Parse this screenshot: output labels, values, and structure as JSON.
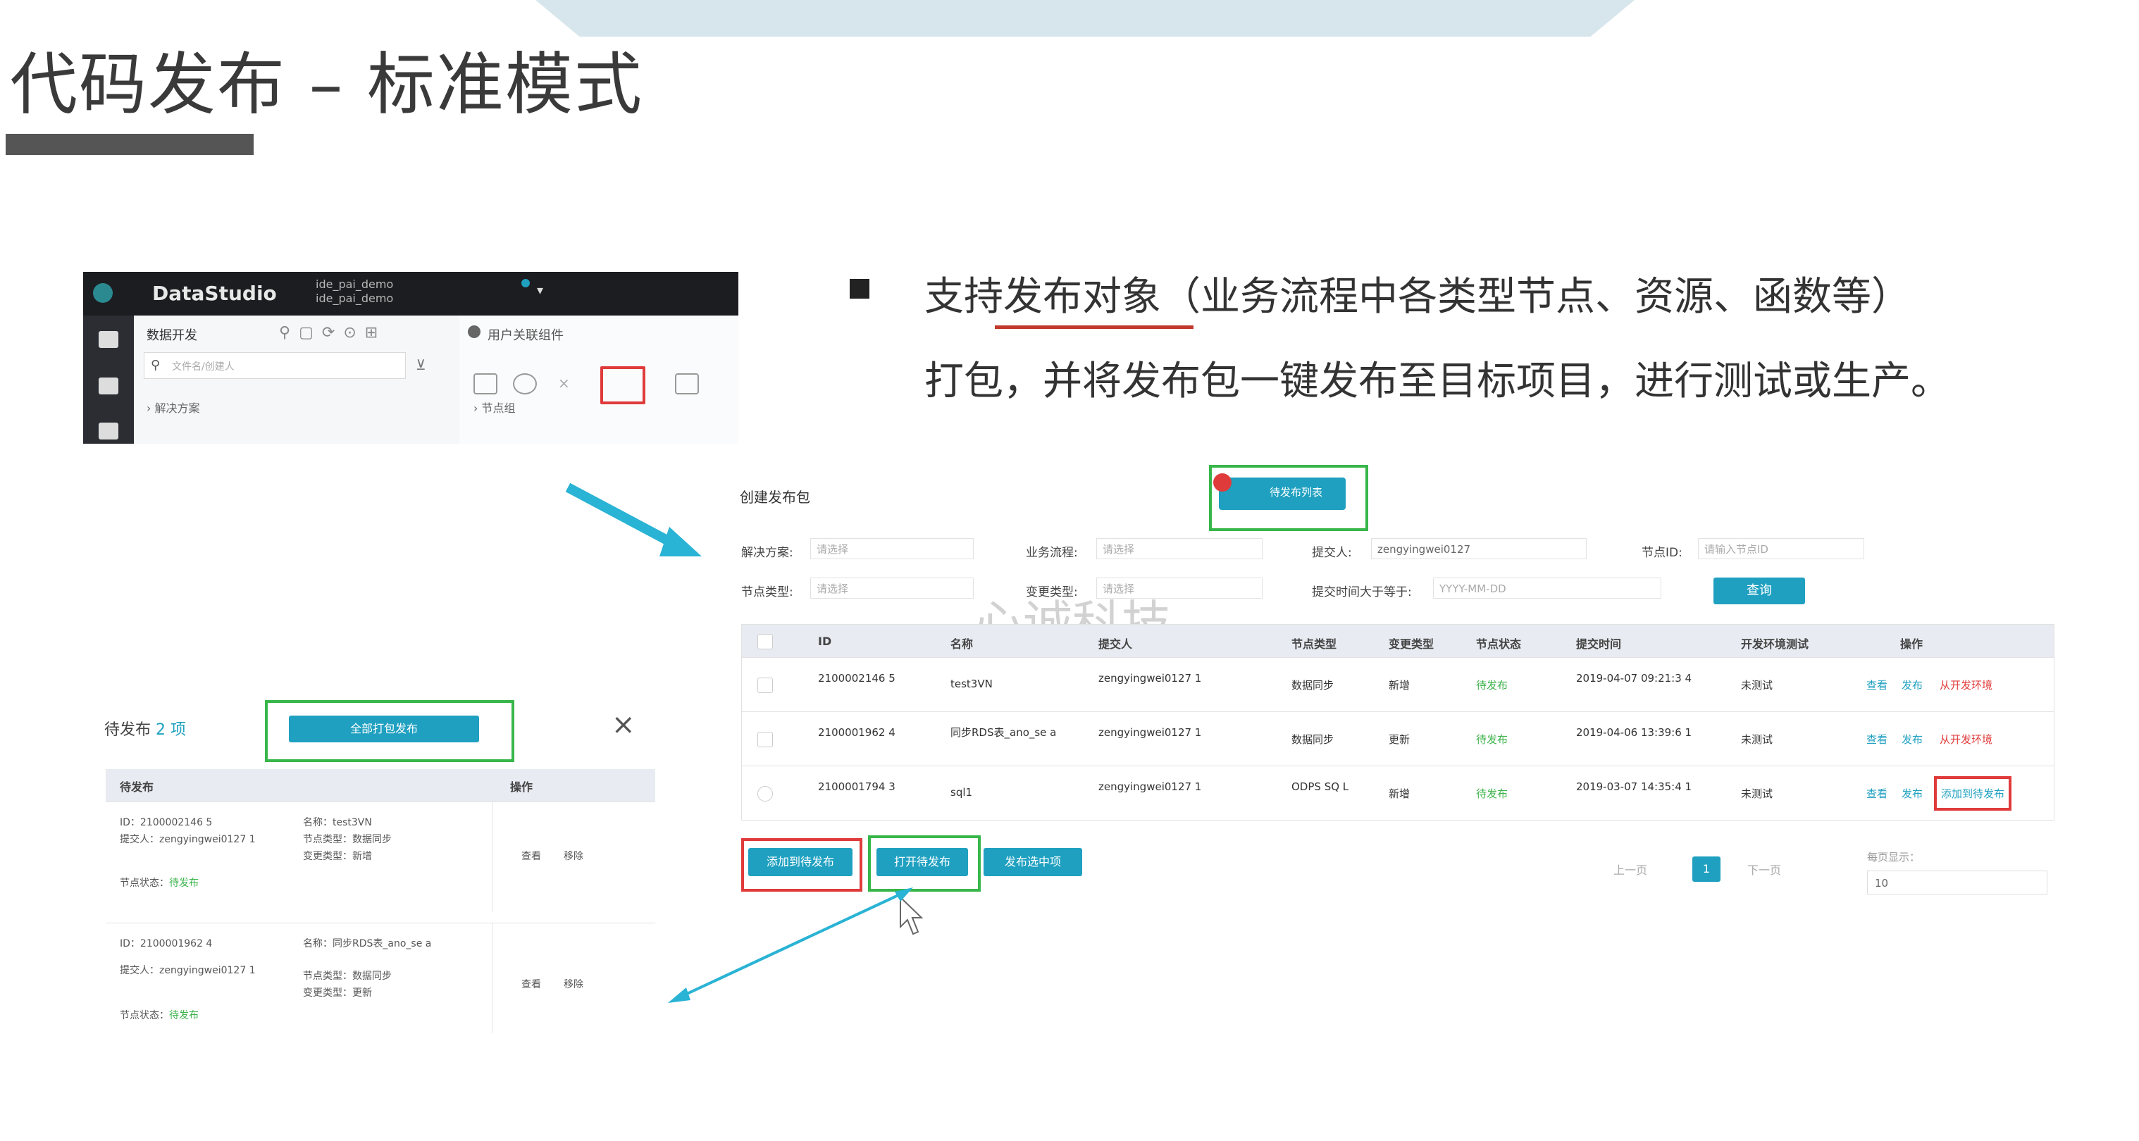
{
  "slide": {
    "title": "代码发布 – 标准模式",
    "bullet_line1": "支持发布对象（业务流程中各类型节点、资源、函数等）",
    "bullet_line2": "打包，并将发布包一键发布至目标项目，进行测试或生产。",
    "watermark": "心诚科技",
    "accent_colors": {
      "teal": "#1fa0c0",
      "red_highlight": "#e03b3b",
      "green_highlight": "#38b64a"
    }
  },
  "datastudio": {
    "app_name": "DataStudio",
    "project_line1": "ide_pai_demo",
    "project_line2": "ide_pai_demo",
    "panel_title": "数据开发",
    "search_placeholder": "文件名/创建人",
    "tree_item": "› 解决方案",
    "tab_label": "用户关联组件",
    "tree_item2": "› 节点组"
  },
  "release_form": {
    "title": "创建发布包",
    "top_button": "待发布列表",
    "fields": [
      {
        "label": "解决方案:",
        "value": "请选择"
      },
      {
        "label": "业务流程:",
        "value": "请选择"
      },
      {
        "label": "提交人:",
        "value": "zengyingwei0127"
      },
      {
        "label": "节点ID:",
        "value": "请输入节点ID"
      },
      {
        "label": "节点类型:",
        "value": "请选择"
      },
      {
        "label": "变更类型:",
        "value": "请选择"
      },
      {
        "label": "提交时间大于等于:",
        "value": "YYYY-MM-DD"
      }
    ],
    "search_button": "查询",
    "columns": [
      "",
      "ID",
      "名称",
      "提交人",
      "节点类型",
      "变更类型",
      "节点状态",
      "提交时间",
      "开发环境测试",
      "操作"
    ],
    "rows": [
      {
        "id": "2100002146 5",
        "name": "test3VN",
        "submitter": "zengyingwei0127 1",
        "node_type": "数据同步",
        "change_type": "新增",
        "status": "待发布",
        "time": "2019-04-07 09:21:3 4",
        "dev_test": "未测试",
        "actions": [
          "查看",
          "发布",
          "从开发环境"
        ]
      },
      {
        "id": "2100001962 4",
        "name": "同步RDS表_ano_se a",
        "submitter": "zengyingwei0127 1",
        "node_type": "数据同步",
        "change_type": "更新",
        "status": "待发布",
        "time": "2019-04-06 13:39:6 1",
        "dev_test": "未测试",
        "actions": [
          "查看",
          "发布",
          "从开发环境"
        ]
      },
      {
        "id": "2100001794 3",
        "name": "sql1",
        "submitter": "zengyingwei0127 1",
        "node_type": "ODPS SQ L",
        "change_type": "新增",
        "status": "待发布",
        "time": "2019-03-07 14:35:4 1",
        "dev_test": "未测试",
        "actions": [
          "查看",
          "发布",
          "添加到待发布"
        ]
      }
    ],
    "bottom_buttons": [
      "添加到待发布",
      "打开待发布",
      "发布选中项"
    ],
    "pagination": {
      "prev": "上一页",
      "current": "1",
      "next": "下一页",
      "page_size_label": "每页显示：",
      "page_size": "10"
    }
  },
  "pending_dialog": {
    "title": "待发布",
    "count": "2 项",
    "top_button": "全部打包发布",
    "close": "×",
    "col_items": "待发布",
    "col_actions": "操作",
    "items": [
      {
        "id": "ID：2100002146 5",
        "name": "名称：test3VN",
        "submitter": "提交人：zengyingwei0127 1",
        "node_type": "节点类型：数据同步",
        "change_type": "变更类型：新增",
        "status_label": "节点状态：",
        "status": "待发布",
        "view": "查看",
        "remove": "移除"
      },
      {
        "id": "ID：2100001962 4",
        "name": "名称：同步RDS表_ano_se a",
        "submitter": "提交人：zengyingwei0127 1",
        "node_type": "节点类型：数据同步",
        "change_type": "变更类型：更新",
        "status_label": "节点状态：",
        "status": "待发布",
        "view": "查看",
        "remove": "移除"
      }
    ]
  }
}
